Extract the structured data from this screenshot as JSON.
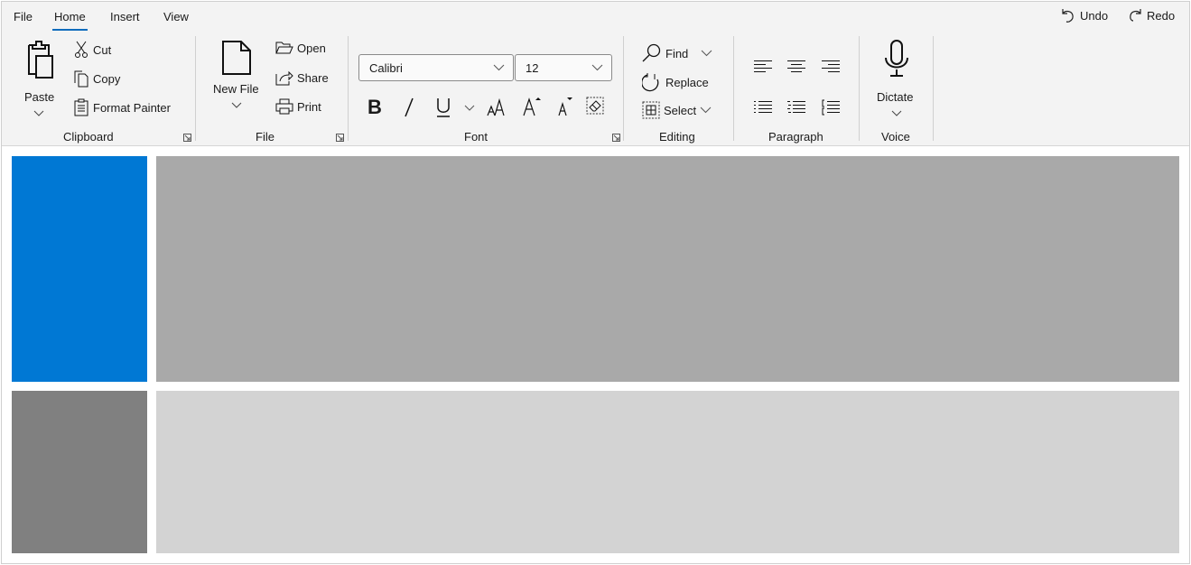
{
  "menu": {
    "tabs": [
      "File",
      "Home",
      "Insert",
      "View"
    ],
    "active": "Home",
    "undo": "Undo",
    "redo": "Redo"
  },
  "clipboard": {
    "label": "Clipboard",
    "paste": "Paste",
    "cut": "Cut",
    "copy": "Copy",
    "format_painter": "Format Painter"
  },
  "file": {
    "label": "File",
    "new_file": "New File",
    "open": "Open",
    "share": "Share",
    "print": "Print"
  },
  "font": {
    "label": "Font",
    "family": "Calibri",
    "size": "12"
  },
  "editing": {
    "label": "Editing",
    "find": "Find",
    "replace": "Replace",
    "select": "Select"
  },
  "paragraph": {
    "label": "Paragraph"
  },
  "voice": {
    "label": "Voice",
    "dictate": "Dictate"
  },
  "colors": {
    "accent": "#0f6cbd",
    "panel_blue": "#0078d4",
    "panel_gray": "#a9a9a9",
    "panel_dark": "#808080",
    "panel_light": "#d3d3d3"
  }
}
